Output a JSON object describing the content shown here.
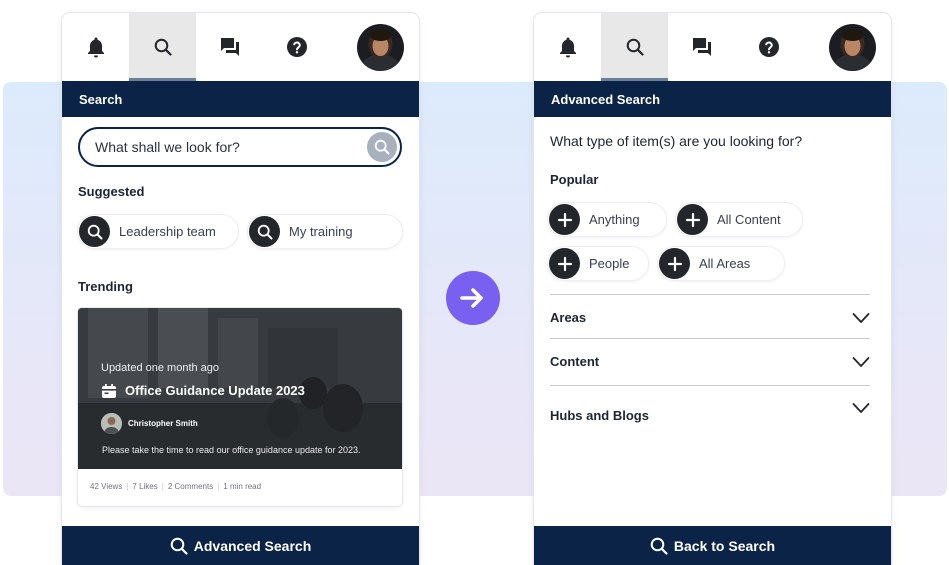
{
  "left": {
    "header": "Search",
    "search": {
      "placeholder": "What shall we look for?"
    },
    "suggested": {
      "label": "Suggested",
      "chips": [
        "Leadership team",
        "My training"
      ]
    },
    "trending": {
      "label": "Trending",
      "card": {
        "updated": "Updated one month ago",
        "title": "Office Guidance Update 2023",
        "author": "Christopher Smith",
        "description": "Please take the time to read our office guidance update for 2023.",
        "views": "42 Views",
        "likes": "7 Likes",
        "comments": "2 Comments",
        "read_time": "1 min read"
      }
    },
    "bottom_button": "Advanced Search"
  },
  "right": {
    "header": "Advanced Search",
    "question": "What type of item(s) are you looking for?",
    "popular": {
      "label": "Popular",
      "chips": [
        "Anything",
        "All Content",
        "People",
        "All Areas"
      ]
    },
    "accordion": [
      "Areas",
      "Content",
      "Hubs and Blogs"
    ],
    "bottom_button": "Back to Search"
  },
  "icons": {
    "topbar": [
      "bell-icon",
      "search-icon",
      "chat-icon",
      "help-icon",
      "avatar"
    ],
    "transition": "arrow-right-icon"
  },
  "colors": {
    "navy": "#0a2346",
    "accent_purple": "#7a60f0",
    "chip_icon": "#23262b",
    "backdrop": "#dcebfb"
  }
}
